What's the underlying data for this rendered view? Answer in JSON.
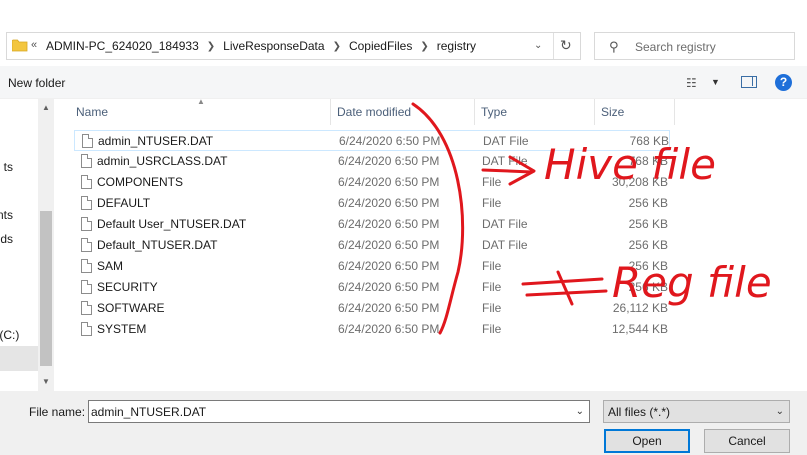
{
  "address": {
    "overflow": "«",
    "crumbs": [
      "ADMIN-PC_624020_184933",
      "LiveResponseData",
      "CopiedFiles",
      "registry"
    ]
  },
  "search": {
    "placeholder": "Search registry"
  },
  "toolbar": {
    "new_folder": "New folder",
    "help": "?"
  },
  "nav": {
    "items": [
      "ts",
      "nts",
      "ds",
      "k (C:)"
    ]
  },
  "columns": {
    "name": "Name",
    "date": "Date modified",
    "type": "Type",
    "size": "Size"
  },
  "files": [
    {
      "name": "admin_NTUSER.DAT",
      "date": "6/24/2020 6:50 PM",
      "type": "DAT File",
      "size": "768 KB"
    },
    {
      "name": "admin_USRCLASS.DAT",
      "date": "6/24/2020 6:50 PM",
      "type": "DAT File",
      "size": "768 KB"
    },
    {
      "name": "COMPONENTS",
      "date": "6/24/2020 6:50 PM",
      "type": "File",
      "size": "30,208 KB"
    },
    {
      "name": "DEFAULT",
      "date": "6/24/2020 6:50 PM",
      "type": "File",
      "size": "256 KB"
    },
    {
      "name": "Default User_NTUSER.DAT",
      "date": "6/24/2020 6:50 PM",
      "type": "DAT File",
      "size": "256 KB"
    },
    {
      "name": "Default_NTUSER.DAT",
      "date": "6/24/2020 6:50 PM",
      "type": "DAT File",
      "size": "256 KB"
    },
    {
      "name": "SAM",
      "date": "6/24/2020 6:50 PM",
      "type": "File",
      "size": "256 KB"
    },
    {
      "name": "SECURITY",
      "date": "6/24/2020 6:50 PM",
      "type": "File",
      "size": "256 KB"
    },
    {
      "name": "SOFTWARE",
      "date": "6/24/2020 6:50 PM",
      "type": "File",
      "size": "26,112 KB"
    },
    {
      "name": "SYSTEM",
      "date": "6/24/2020 6:50 PM",
      "type": "File",
      "size": "12,544 KB"
    }
  ],
  "bottom": {
    "file_name_label": "File name:",
    "file_name_value": "admin_NTUSER.DAT",
    "filter": "All files (*.*)",
    "open": "Open",
    "cancel": "Cancel"
  },
  "annotations": {
    "hive": "Hive file",
    "reg": "Reg file",
    "color": "#e0171d"
  },
  "colors": {
    "accent": "#0078d7",
    "selection_border": "#cce8ff",
    "folder": "#f3c63f"
  }
}
